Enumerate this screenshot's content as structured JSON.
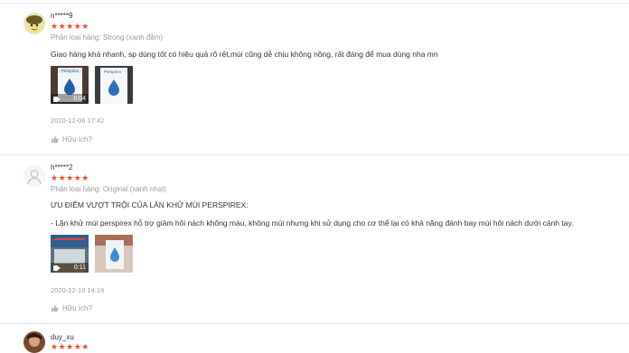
{
  "reviews": [
    {
      "username": "n*****9",
      "stars": "★★★★★",
      "variant": "Phân loại hàng: Strong (xanh đậm)",
      "text_lines": [
        "Giao hàng khá nhanh, sp dùng tốt có hiệu quả rõ rệt,mùi cũng dễ chịu không nồng, rất đáng để mua dùng nha mn"
      ],
      "media": [
        {
          "kind": "video",
          "duration": "0:04",
          "brand": "Perspirex"
        },
        {
          "kind": "image",
          "brand": "Perspirex"
        }
      ],
      "timestamp": "2020-12-06 17:42",
      "helpful_label": "Hữu ích?"
    },
    {
      "username": "h*****2",
      "stars": "★★★★★",
      "variant": "Phân loại hàng: Original (xanh nhạt)",
      "text_lines": [
        "ƯU ĐIỂM VƯỢT TRỘI CỦA LĂN KHỬ MÙI PERSPIREX:",
        "- Lăn khử mùi perspirex hỗ trợ giảm hôi nách không màu, không mùi nhưng khi sử dụng cho cơ thể lại có khả năng đánh bay mùi hôi nách dưới cánh tay."
      ],
      "media": [
        {
          "kind": "video",
          "duration": "0:11",
          "brand": ""
        },
        {
          "kind": "image",
          "brand": ""
        }
      ],
      "timestamp": "2020-12-10 14:19",
      "helpful_label": "Hữu ích?"
    },
    {
      "username": "duy_xu",
      "stars": "★★★★★"
    }
  ],
  "colors": {
    "star": "#ee4d2d",
    "muted": "#9a9a9a",
    "divider": "#e8e8e8"
  }
}
